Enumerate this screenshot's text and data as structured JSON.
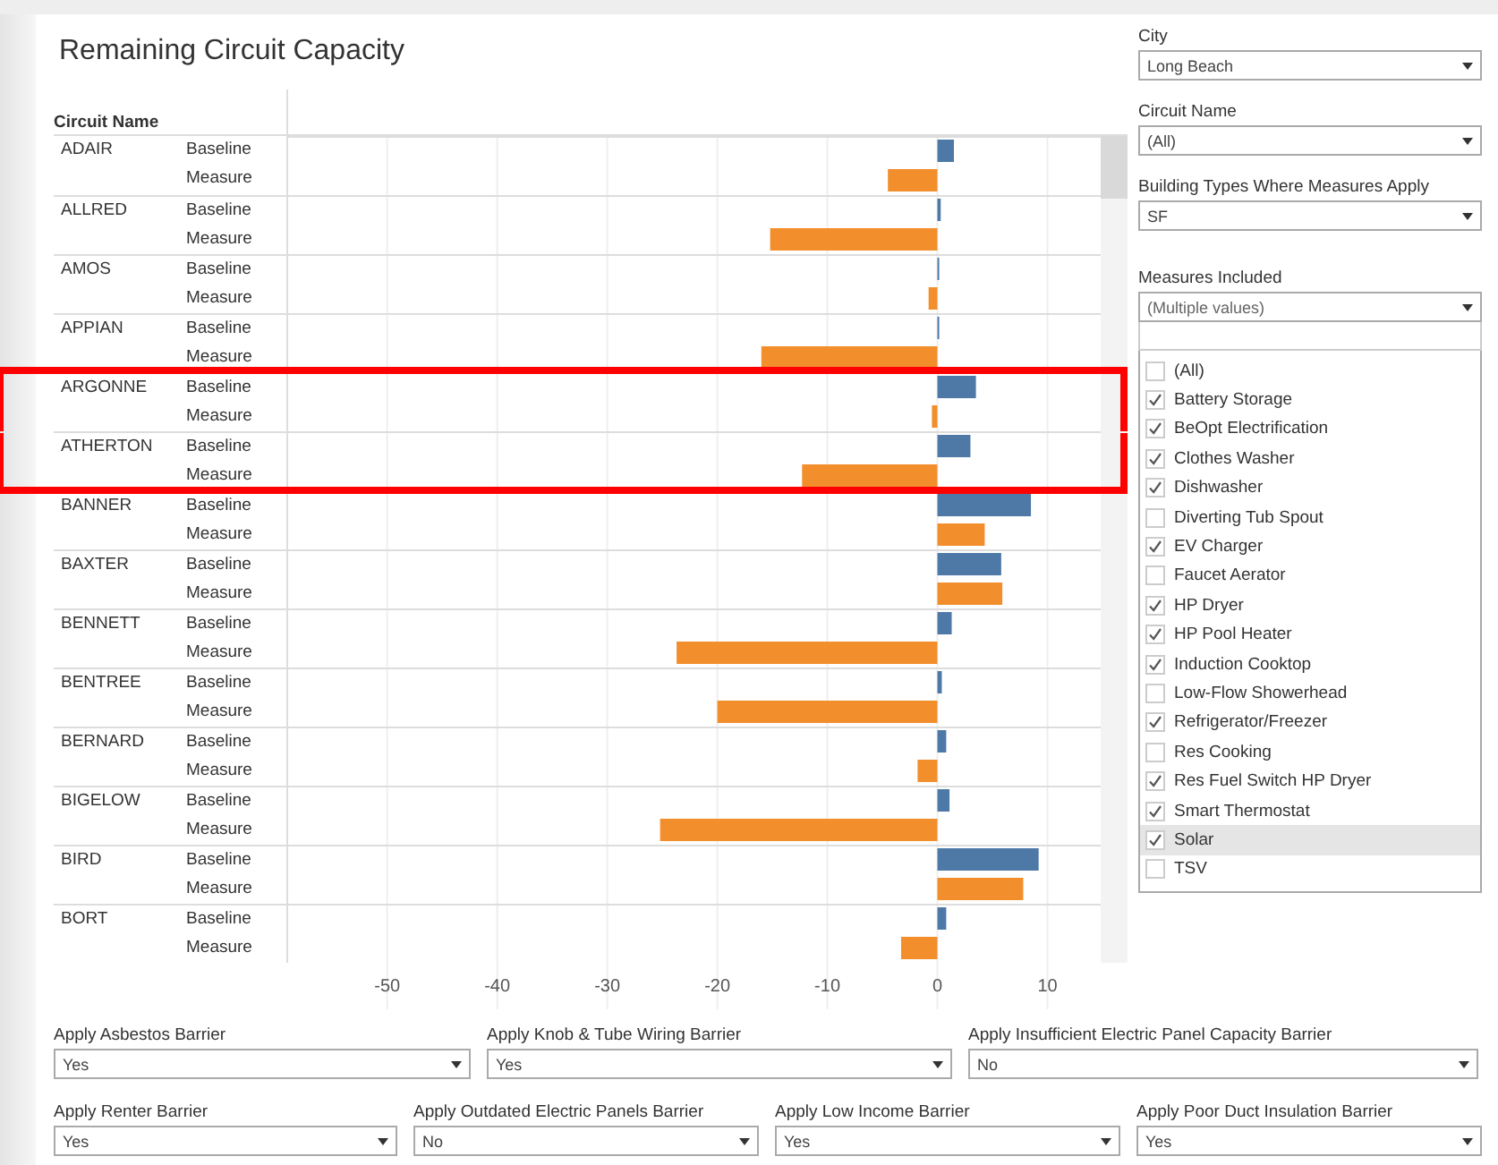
{
  "title": "Remaining Circuit Capacity",
  "table": {
    "column_header": "Circuit Name",
    "circuits": [
      {
        "name": "ADAIR",
        "highlighted": false,
        "rows": [
          "Baseline",
          "Measure"
        ]
      },
      {
        "name": "ALLRED",
        "highlighted": false,
        "rows": [
          "Baseline",
          "Measure"
        ]
      },
      {
        "name": "AMOS",
        "highlighted": false,
        "rows": [
          "Baseline",
          "Measure"
        ]
      },
      {
        "name": "APPIAN",
        "highlighted": false,
        "rows": [
          "Baseline",
          "Measure"
        ]
      },
      {
        "name": "ARGONNE",
        "highlighted": true,
        "rows": [
          "Baseline",
          "Measure"
        ]
      },
      {
        "name": "ATHERTON",
        "highlighted": true,
        "rows": [
          "Baseline",
          "Measure"
        ]
      },
      {
        "name": "BANNER",
        "highlighted": false,
        "rows": [
          "Baseline",
          "Measure"
        ]
      },
      {
        "name": "BAXTER",
        "highlighted": false,
        "rows": [
          "Baseline",
          "Measure"
        ]
      },
      {
        "name": "BENNETT",
        "highlighted": false,
        "rows": [
          "Baseline",
          "Measure"
        ]
      },
      {
        "name": "BENTREE",
        "highlighted": false,
        "rows": [
          "Baseline",
          "Measure"
        ]
      },
      {
        "name": "BERNARD",
        "highlighted": false,
        "rows": [
          "Baseline",
          "Measure"
        ]
      },
      {
        "name": "BIGELOW",
        "highlighted": false,
        "rows": [
          "Baseline",
          "Measure"
        ]
      },
      {
        "name": "BIRD",
        "highlighted": false,
        "rows": [
          "Baseline",
          "Measure"
        ]
      },
      {
        "name": "BORT",
        "highlighted": false,
        "rows": [
          "Baseline",
          "Measure"
        ]
      }
    ]
  },
  "chart_data": {
    "type": "bar",
    "orientation": "horizontal",
    "grid": true,
    "xlim": [
      -59,
      15
    ],
    "xticks": [
      -50,
      -40,
      -30,
      -20,
      -10,
      0,
      10
    ],
    "series": [
      {
        "color": "#4e79a7",
        "values": [
          1.5,
          0.3,
          0.1,
          0.1,
          3.5,
          3,
          8.5,
          5.8,
          1.3,
          0.4,
          0.8,
          1.1,
          9.2,
          0.8
        ]
      },
      {
        "color": "#f28e2b",
        "values": [
          -4.5,
          -15.2,
          -0.8,
          -16,
          -0.5,
          -12.3,
          4.3,
          5.9,
          -23.7,
          -20,
          -1.8,
          -25.2,
          7.8,
          -3.3
        ]
      }
    ]
  },
  "side_filters": [
    {
      "label": "City",
      "value": "Long Beach"
    },
    {
      "label": "Circuit Name",
      "value": "(All)"
    },
    {
      "label": "Building Types Where Measures Apply",
      "value": "SF"
    }
  ],
  "measures_filter": {
    "label": "Measures Included",
    "value": "(Multiple values)",
    "options": [
      {
        "label": "(All)",
        "checked": false,
        "hovered": false
      },
      {
        "label": "Battery Storage",
        "checked": true,
        "hovered": false
      },
      {
        "label": "BeOpt Electrification",
        "checked": true,
        "hovered": false
      },
      {
        "label": "Clothes Washer",
        "checked": true,
        "hovered": false
      },
      {
        "label": "Dishwasher",
        "checked": true,
        "hovered": false
      },
      {
        "label": "Diverting Tub Spout",
        "checked": false,
        "hovered": false
      },
      {
        "label": "EV Charger",
        "checked": true,
        "hovered": false
      },
      {
        "label": "Faucet Aerator",
        "checked": false,
        "hovered": false
      },
      {
        "label": "HP Dryer",
        "checked": true,
        "hovered": false
      },
      {
        "label": "HP Pool Heater",
        "checked": true,
        "hovered": false
      },
      {
        "label": "Induction Cooktop",
        "checked": true,
        "hovered": false
      },
      {
        "label": "Low-Flow Showerhead",
        "checked": false,
        "hovered": false
      },
      {
        "label": "Refrigerator/Freezer",
        "checked": true,
        "hovered": false
      },
      {
        "label": "Res Cooking",
        "checked": false,
        "hovered": false
      },
      {
        "label": "Res Fuel Switch HP Dryer",
        "checked": true,
        "hovered": false
      },
      {
        "label": "Smart Thermostat",
        "checked": true,
        "hovered": false
      },
      {
        "label": "Solar",
        "checked": true,
        "hovered": true
      },
      {
        "label": "TSV",
        "checked": false,
        "hovered": false
      }
    ]
  },
  "bottom_filters": [
    [
      {
        "label": "Apply Asbestos Barrier",
        "value": "Yes"
      },
      {
        "label": "Apply Knob & Tube Wiring Barrier",
        "value": "Yes"
      },
      {
        "label": "Apply Insufficient Electric Panel Capacity Barrier",
        "value": "No"
      }
    ],
    [
      {
        "label": "Apply Renter Barrier",
        "value": "Yes"
      },
      {
        "label": "Apply Outdated Electric Panels Barrier",
        "value": "No"
      },
      {
        "label": "Apply Low Income Barrier",
        "value": "Yes"
      },
      {
        "label": "Apply Poor Duct Insulation Barrier",
        "value": "Yes"
      }
    ]
  ]
}
